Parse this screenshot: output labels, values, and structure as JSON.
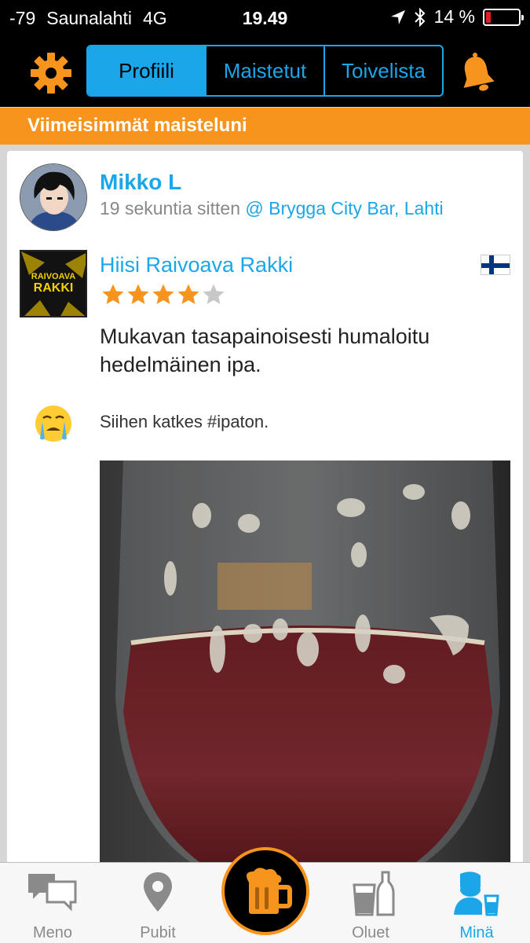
{
  "status_bar": {
    "signal": "-79",
    "carrier": "Saunalahti",
    "network": "4G",
    "time": "19.49",
    "battery": "14 %",
    "battery_level": 0.14
  },
  "nav": {
    "tabs": [
      {
        "label": "Profiili",
        "active": true
      },
      {
        "label": "Maistetut",
        "active": false
      },
      {
        "label": "Toivelista",
        "active": false
      }
    ],
    "icons": [
      "gear-icon",
      "bell-icon"
    ]
  },
  "section": {
    "title": "Viimeisimmät maisteluni"
  },
  "checkin": {
    "user_name": "Mikko L",
    "time_ago": "19 sekuntia sitten",
    "venue": "@ Brygga City Bar, Lahti",
    "beer": {
      "name": "Hiisi Raivoava Rakki",
      "label_top": "RAIVOAVA",
      "label_bottom": "RAKKI",
      "country_flag": "finland-flag-icon",
      "rating": 4,
      "rating_max": 5
    },
    "review": "Mukavan tasapainoisesti humaloitu hedelmäinen ipa.",
    "comment_emoji": "crying-face-icon",
    "comment": "Siihen katkes #ipaton."
  },
  "tab_bar": {
    "items": [
      {
        "label": "Meno",
        "icon": "chat-bubbles-icon",
        "active": false
      },
      {
        "label": "Pubit",
        "icon": "map-pin-icon",
        "active": false
      },
      {
        "label": "",
        "icon": "beer-mug-icon",
        "active": false
      },
      {
        "label": "Oluet",
        "icon": "glass-bottle-icon",
        "active": false
      },
      {
        "label": "Minä",
        "icon": "user-beer-icon",
        "active": true
      }
    ]
  },
  "colors": {
    "accent_blue": "#1aa6e8",
    "accent_orange": "#f7941d",
    "battery_low": "#e02020"
  }
}
